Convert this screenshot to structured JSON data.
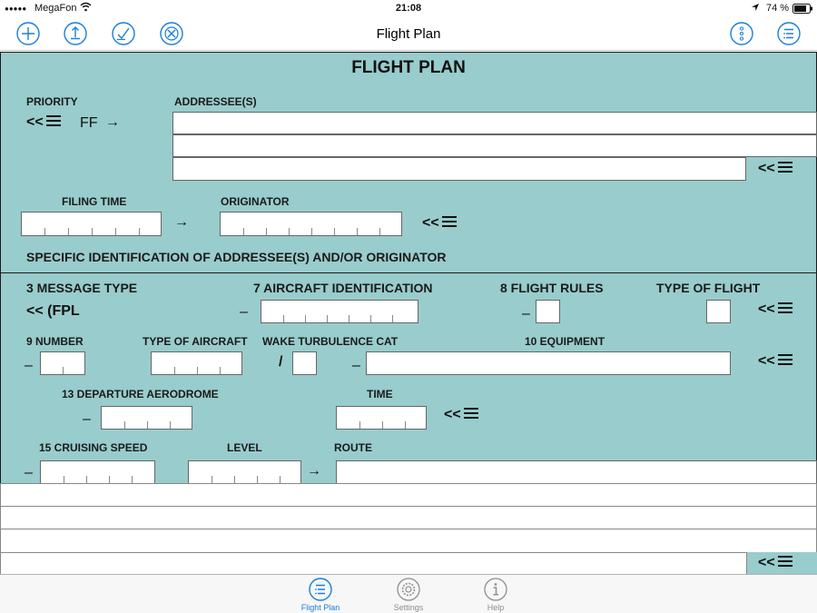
{
  "status_bar": {
    "signal": "●●●●●",
    "carrier": "MegaFon",
    "time": "21:08",
    "battery": "74 %"
  },
  "nav": {
    "title": "Flight Plan"
  },
  "form": {
    "title": "FLIGHT PLAN",
    "priority_label": "PRIORITY",
    "addressees_label": "ADDRESSEE(S)",
    "priority_prefix": "<<",
    "priority_value": "FF",
    "arrow": "→",
    "filing_time_label": "FILING TIME",
    "originator_label": "ORIGINATOR",
    "specific_id_label": "SPECIFIC IDENTIFICATION OF ADDRESSEE(S) AND/OR ORIGINATOR",
    "message_type_label": "3  MESSAGE TYPE",
    "message_type_value": "<< (FPL",
    "aircraft_id_label": "7  AIRCRAFT IDENTIFICATION",
    "flight_rules_label": "8 FLIGHT RULES",
    "type_of_flight_label": "TYPE OF FLIGHT",
    "number_label": "9 NUMBER",
    "type_of_aircraft_label": "TYPE OF AIRCRAFT",
    "wake_label": "WAKE TURBULENCE CAT",
    "equipment_label": "10 EQUIPMENT",
    "departure_label": "13 DEPARTURE AERODROME",
    "time_label": "TIME",
    "speed_label": "15 CRUISING SPEED",
    "level_label": "LEVEL",
    "route_label": "ROUTE",
    "dash": "–",
    "slash": "/",
    "return_symbol": "<<"
  },
  "tabs": [
    {
      "label": "Flight Plan",
      "active": true
    },
    {
      "label": "Settings",
      "active": false
    },
    {
      "label": "Help",
      "active": false
    }
  ],
  "colors": {
    "form_bg": "#99cccc",
    "accent": "#1a7fd9",
    "inactive": "#8e8e93"
  },
  "icons": {
    "add": "plus-circle-icon",
    "upload": "upload-circle-icon",
    "check": "check-circle-icon",
    "cancel": "x-circle-icon",
    "more": "more-vertical-icon",
    "list": "list-circle-icon"
  }
}
